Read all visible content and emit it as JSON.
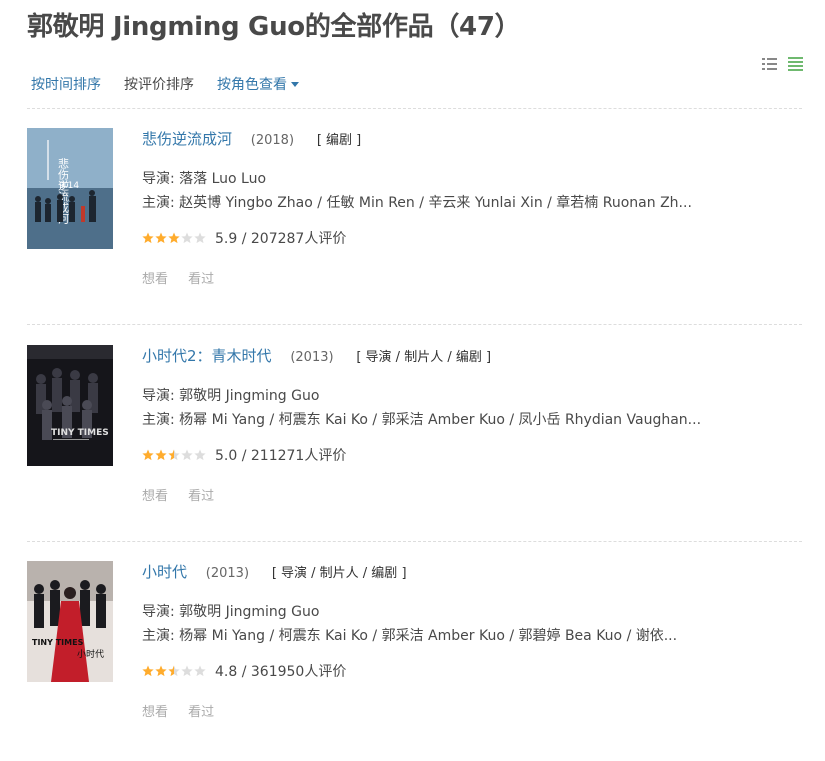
{
  "page_title": "郭敬明 Jingming Guo的全部作品（47）",
  "sort": {
    "by_time": "按时间排序",
    "by_rating": "按评价排序",
    "by_role": "按角色查看"
  },
  "colors": {
    "link": "#3377aa",
    "star_on": "#ffac2d",
    "star_off": "#dddddd"
  },
  "items": [
    {
      "title": "悲伤逆流成河",
      "year": "(2018)",
      "roles": "[ 编剧 ]",
      "director": "导演: 落落 Luo Luo",
      "cast": "主演: 赵英博 Yingbo Zhao / 任敏 Min Ren / 辛云来 Yunlai Xin / 章若楠 Ruonan Zh...",
      "rating_text": "5.9 / 207287人评价",
      "rating": 5.9,
      "want": "想看",
      "seen": "看过",
      "poster_text": "悲伤逆流成河",
      "poster_date": "9.14"
    },
    {
      "title": "小时代2：青木时代",
      "year": "(2013)",
      "roles": "[ 导演 / 制片人 / 编剧 ]",
      "director": "导演: 郭敬明 Jingming Guo",
      "cast": "主演: 杨幂 Mi Yang / 柯震东 Kai Ko / 郭采洁 Amber Kuo / 凤小岳 Rhydian Vaughan...",
      "rating_text": "5.0 / 211271人评价",
      "rating": 5.0,
      "want": "想看",
      "seen": "看过",
      "poster_text": "TINY TIMES"
    },
    {
      "title": "小时代",
      "year": "(2013)",
      "roles": "[ 导演 / 制片人 / 编剧 ]",
      "director": "导演: 郭敬明 Jingming Guo",
      "cast": "主演: 杨幂 Mi Yang / 柯震东 Kai Ko / 郭采洁 Amber Kuo / 郭碧婷 Bea Kuo / 谢依...",
      "rating_text": "4.8 / 361950人评价",
      "rating": 4.8,
      "want": "想看",
      "seen": "看过",
      "poster_text": "TINY TIMES",
      "poster_subtitle": "小时代"
    }
  ]
}
